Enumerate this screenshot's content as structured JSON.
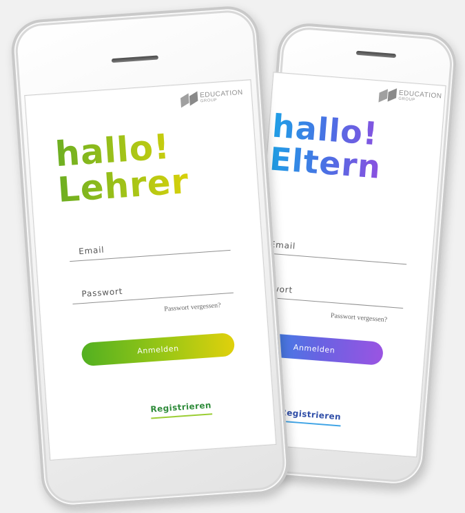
{
  "phones": {
    "eltern": {
      "logo": {
        "main": "EDUCATION",
        "sub": "GROUP"
      },
      "headline": {
        "line1": "hallo!",
        "line2": "Eltern"
      },
      "email_label": "Email",
      "password_label": "asswort",
      "forgot_password": "Passwort vergessen?",
      "login_button": "Anmelden",
      "register_link": "Registrieren",
      "accent_colors": [
        "#1ea0e6",
        "#4a70e4",
        "#8d4fe0"
      ]
    },
    "lehrer": {
      "logo": {
        "main": "EDUCATION",
        "sub": "GROUP"
      },
      "headline": {
        "line1": "hallo!",
        "line2": "Lehrer"
      },
      "email_label": "Email",
      "password_label": "Passwort",
      "forgot_password": "Passwort vergessen?",
      "login_button": "Anmelden",
      "register_link": "Registrieren",
      "accent_colors": [
        "#6cae22",
        "#a5c417",
        "#d9d10a"
      ]
    }
  }
}
